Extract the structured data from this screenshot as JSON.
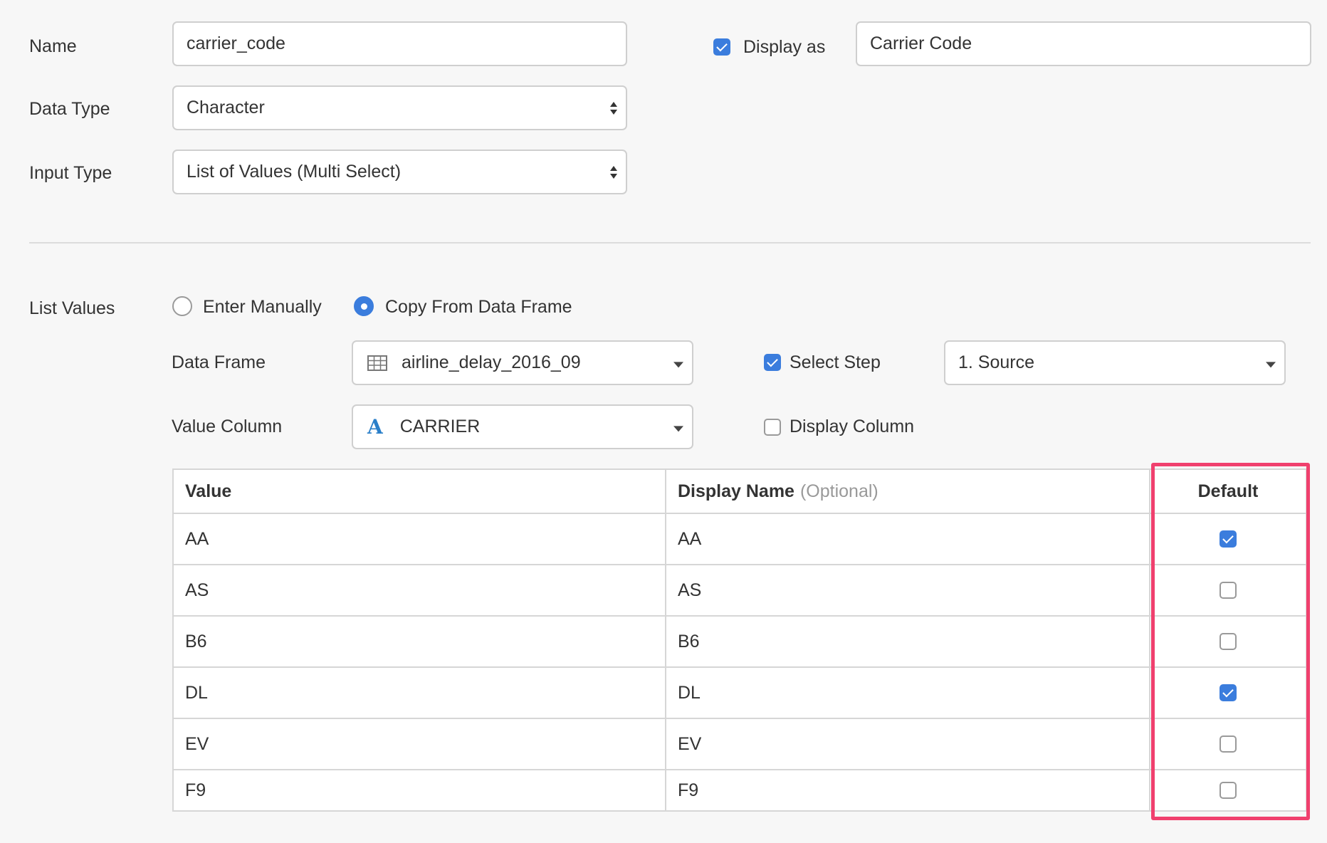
{
  "form": {
    "name_label": "Name",
    "name_value": "carrier_code",
    "display_as_label": "Display as",
    "display_as_checked": true,
    "display_as_value": "Carrier Code",
    "data_type_label": "Data Type",
    "data_type_value": "Character",
    "input_type_label": "Input Type",
    "input_type_value": "List of Values (Multi Select)"
  },
  "list_values": {
    "label": "List Values",
    "option_manual": "Enter Manually",
    "option_copy": "Copy From Data Frame",
    "selected": "copy",
    "data_frame_label": "Data Frame",
    "data_frame_value": "airline_delay_2016_09",
    "select_step_label": "Select Step",
    "select_step_checked": true,
    "select_step_value": "1. Source",
    "value_column_label": "Value Column",
    "value_column_type_icon": "A",
    "value_column_value": "CARRIER",
    "display_column_label": "Display Column",
    "display_column_checked": false
  },
  "table": {
    "headers": {
      "value": "Value",
      "display_name": "Display Name",
      "display_name_hint": "(Optional)",
      "default": "Default"
    },
    "rows": [
      {
        "value": "AA",
        "display": "AA",
        "default": true
      },
      {
        "value": "AS",
        "display": "AS",
        "default": false
      },
      {
        "value": "B6",
        "display": "B6",
        "default": false
      },
      {
        "value": "DL",
        "display": "DL",
        "default": true
      },
      {
        "value": "EV",
        "display": "EV",
        "default": false
      },
      {
        "value": "F9",
        "display": "F9",
        "default": false
      }
    ]
  },
  "colors": {
    "accent": "#3b7ddd",
    "highlight": "#f0406e"
  }
}
